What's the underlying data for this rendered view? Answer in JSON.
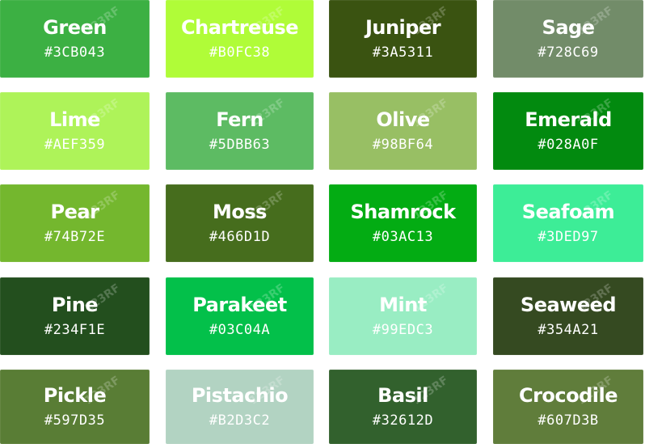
{
  "swatches": [
    {
      "name": "Green",
      "hex": "#3CB043",
      "color": "#3CB043"
    },
    {
      "name": "Chartreuse",
      "hex": "#B0FC38",
      "color": "#B0FC38"
    },
    {
      "name": "Juniper",
      "hex": "#3A5311",
      "color": "#3A5311"
    },
    {
      "name": "Sage",
      "hex": "#728C69",
      "color": "#728C69"
    },
    {
      "name": "Lime",
      "hex": "#AEF359",
      "color": "#AEF359"
    },
    {
      "name": "Fern",
      "hex": "#5DBB63",
      "color": "#5DBB63"
    },
    {
      "name": "Olive",
      "hex": "#98BF64",
      "color": "#98BF64"
    },
    {
      "name": "Emerald",
      "hex": "#028A0F",
      "color": "#028A0F"
    },
    {
      "name": "Pear",
      "hex": "#74B72E",
      "color": "#74B72E"
    },
    {
      "name": "Moss",
      "hex": "#466D1D",
      "color": "#466D1D"
    },
    {
      "name": "Shamrock",
      "hex": "#03AC13",
      "color": "#03AC13"
    },
    {
      "name": "Seafoam",
      "hex": "#3DED97",
      "color": "#3DED97"
    },
    {
      "name": "Pine",
      "hex": "#234F1E",
      "color": "#234F1E"
    },
    {
      "name": "Parakeet",
      "hex": "#03C04A",
      "color": "#03C04A"
    },
    {
      "name": "Mint",
      "hex": "#99EDC3",
      "color": "#99EDC3"
    },
    {
      "name": "Seaweed",
      "hex": "#354A21",
      "color": "#354A21"
    },
    {
      "name": "Pickle",
      "hex": "#597D35",
      "color": "#597D35"
    },
    {
      "name": "Pistachio",
      "hex": "#B2D3C2",
      "color": "#B2D3C2"
    },
    {
      "name": "Basil",
      "hex": "#32612D",
      "color": "#32612D"
    },
    {
      "name": "Crocodile",
      "hex": "#607D3B",
      "color": "#607D3B"
    }
  ],
  "watermark": "123RF"
}
